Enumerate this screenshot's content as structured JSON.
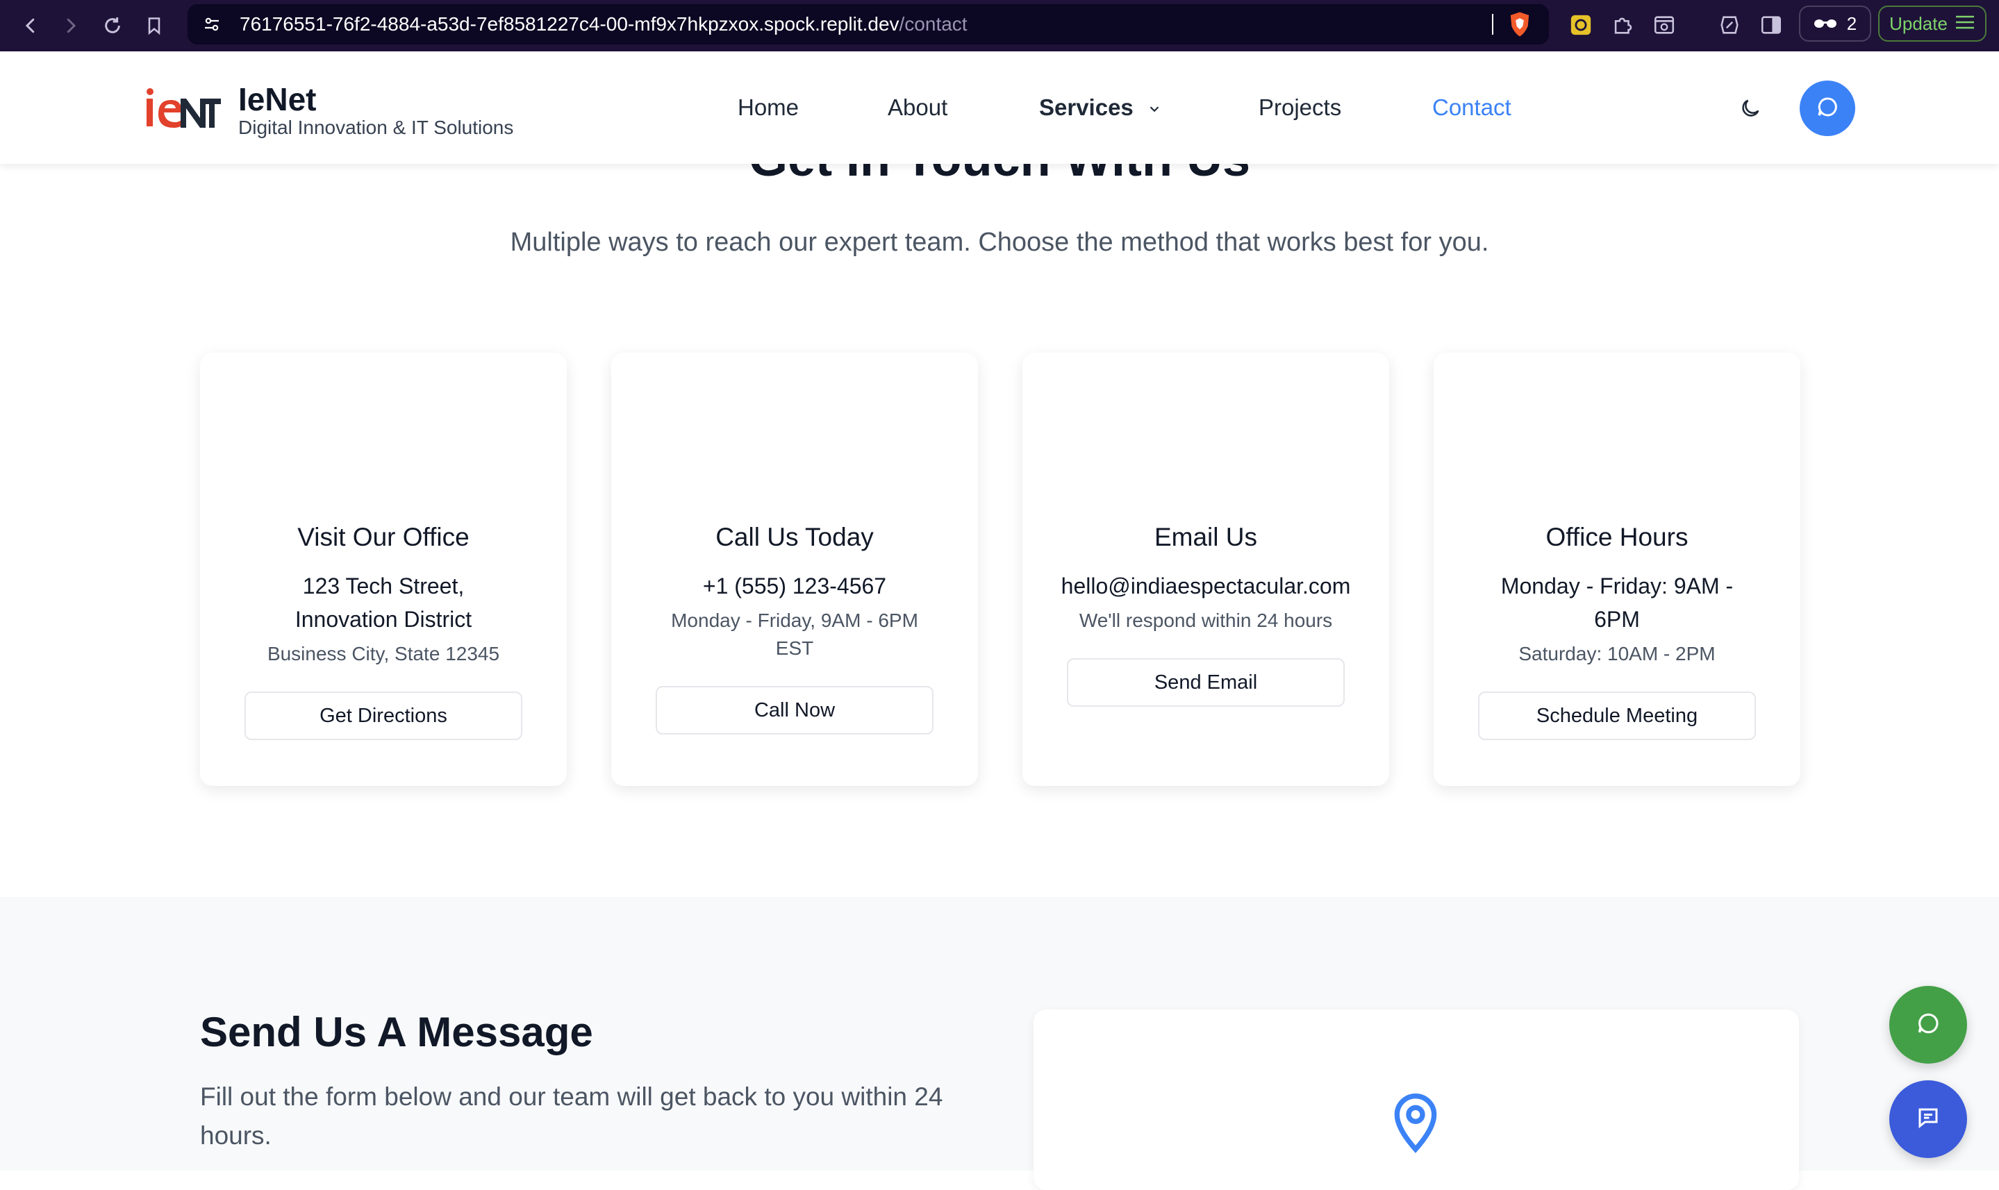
{
  "browser": {
    "url_host": "76176551-76f2-4884-a53d-7ef8581227c4-00-mf9x7hkpzxox.spock.replit.dev",
    "url_path": "/contact",
    "extension_count": "2",
    "update_label": "Update",
    "icons": [
      "back-icon",
      "forward-icon",
      "reload-icon",
      "bookmark-icon",
      "site-settings-icon",
      "brave-shield-icon",
      "extension-icon",
      "puzzle-icon",
      "reader-icon",
      "leo-icon",
      "sidebar-icon",
      "glasses-icon",
      "menu-icon"
    ],
    "colors": {
      "chrome_bg": "#1e1238",
      "url_bg": "#0c0722",
      "update_green": "#7ed36b"
    }
  },
  "header": {
    "logo_text": "ieNT",
    "brand_name": "IeNet",
    "tagline": "Digital Innovation & IT Solutions",
    "nav": [
      {
        "label": "Home"
      },
      {
        "label": "About"
      },
      {
        "label": "Services"
      },
      {
        "label": "Projects"
      },
      {
        "label": "Contact"
      }
    ],
    "active": "Contact",
    "accent": "#3b82f6"
  },
  "hero": {
    "title": "Get In Touch With Us",
    "subtitle": "Multiple ways to reach our expert team. Choose the method that works best for you."
  },
  "cards": [
    {
      "title": "Visit Our Office",
      "main": "123 Tech Street, Innovation District",
      "sub": "Business City, State 12345",
      "button": "Get Directions"
    },
    {
      "title": "Call Us Today",
      "main": "+1 (555) 123-4567",
      "sub": "Monday - Friday, 9AM - 6PM EST",
      "button": "Call Now"
    },
    {
      "title": "Email Us",
      "main": "hello@indiaespectacular.com",
      "sub": "We'll respond within 24 hours",
      "button": "Send Email"
    },
    {
      "title": "Office Hours",
      "main": "Monday - Friday: 9AM - 6PM",
      "sub": "Saturday: 10AM - 2PM",
      "button": "Schedule Meeting"
    }
  ],
  "message": {
    "title": "Send Us A Message",
    "description": "Fill out the form below and our team will get back to you within 24 hours."
  },
  "fabs": {
    "green": "#43a047",
    "blue": "#3b5bdb"
  }
}
